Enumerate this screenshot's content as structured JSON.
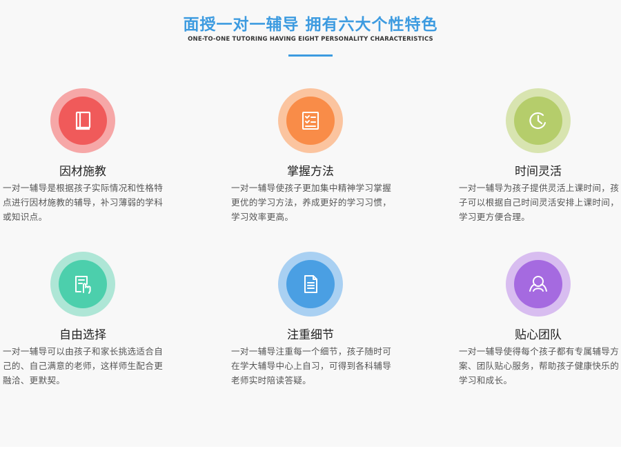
{
  "header": {
    "title": "面授一对一辅导 拥有六大个性特色",
    "subtitle": "ONE-TO-ONE TUTORING  HAVING EIGHT PERSONALITY CHARACTERISTICS",
    "accent_color": "#3d9be0"
  },
  "features": [
    {
      "title": "因材施教",
      "description": "一对一辅导是根据孩子实际情况和性格特点进行因材施教的辅导，补习薄弱的学科或知识点。",
      "icon": "book-icon",
      "color_outer": "#f6a7a7",
      "color_inner": "#f05a5a"
    },
    {
      "title": "掌握方法",
      "description": "一对一辅导使孩子更加集中精神学习掌握更优的学习方法，养成更好的学习习惯，学习效率更高。",
      "icon": "checklist-icon",
      "color_outer": "#fbc49f",
      "color_inner": "#f98c48"
    },
    {
      "title": "时间灵活",
      "description": "一对一辅导为孩子提供灵活上课时间，孩子可以根据自己时间灵活安排上课时间，学习更方便合理。",
      "icon": "clock-icon",
      "color_outer": "#d8e4b0",
      "color_inner": "#b5cd6b"
    },
    {
      "title": "自由选择",
      "description": "一对一辅导可以由孩子和家长挑选适合自己的、自己满意的老师，这样师生配合更融洽、更默契。",
      "icon": "hand-select-icon",
      "color_outer": "#aee6d6",
      "color_inner": "#4ccfac"
    },
    {
      "title": "注重细节",
      "description": "一对一辅导注重每一个细节，孩子随时可在学大辅导中心上自习，可得到各科辅导老师实时陪读答疑。",
      "icon": "document-icon",
      "color_outer": "#a9d0f2",
      "color_inner": "#4a9fe3"
    },
    {
      "title": "贴心团队",
      "description": "一对一辅导使得每个孩子都有专属辅导方案、团队贴心服务，帮助孩子健康快乐的学习和成长。",
      "icon": "team-icon",
      "color_outer": "#d8bdf0",
      "color_inner": "#a56ae0"
    }
  ]
}
